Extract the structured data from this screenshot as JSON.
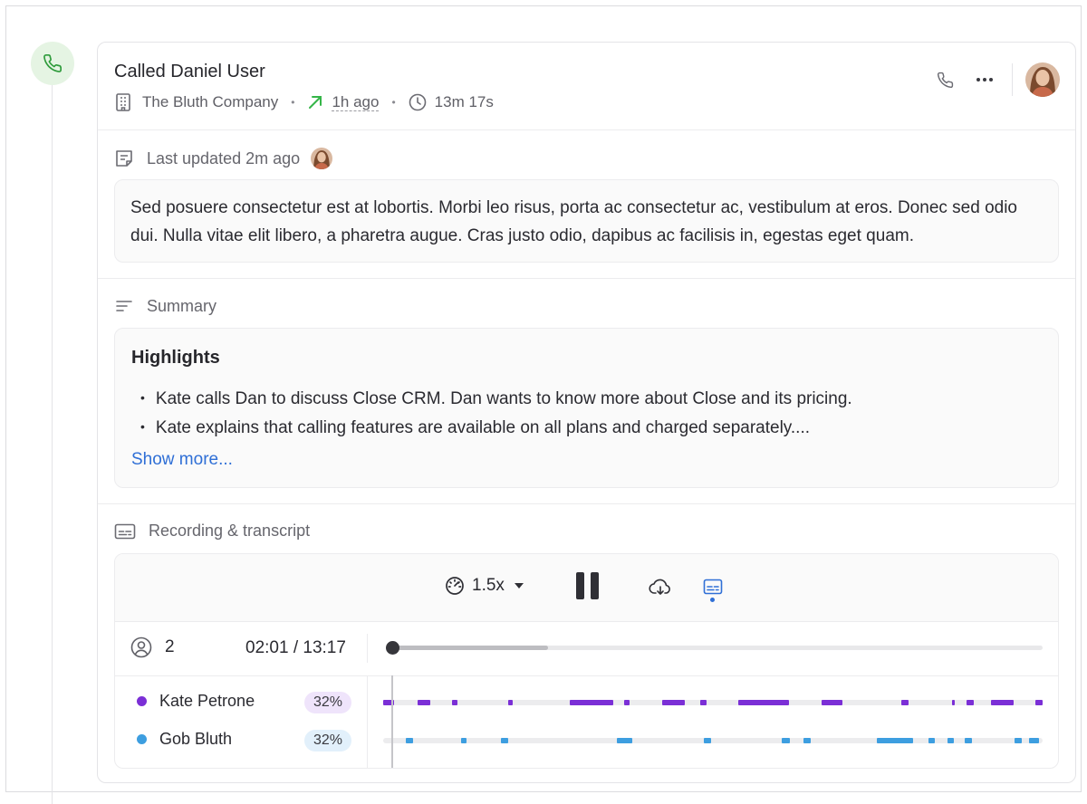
{
  "activity": {
    "title": "Called Daniel User",
    "company": "The Bluth Company",
    "time_ago": "1h ago",
    "duration": "13m 17s"
  },
  "note": {
    "updated_label": "Last updated 2m ago",
    "text": "Sed posuere consectetur est at lobortis. Morbi leo risus, porta ac consectetur ac, vestibulum at eros. Donec sed odio dui. Nulla vitae elit libero, a pharetra augue. Cras justo odio, dapibus ac facilisis in, egestas eget quam."
  },
  "summary": {
    "label": "Summary",
    "highlights_title": "Highlights",
    "bullets": [
      "Kate calls Dan to discuss Close CRM. Dan wants to know more about Close and its pricing.",
      "Kate explains that calling features are available on all plans and charged separately...."
    ],
    "show_more": "Show more..."
  },
  "recording": {
    "label": "Recording & transcript",
    "speed": "1.5x",
    "participants_count": "2",
    "time": "02:01 / 13:17",
    "progress_fraction": 0.24,
    "playhead_fraction": 0.0,
    "speakers": [
      {
        "name": "Kate Petrone",
        "percent": "32%",
        "color": "#7b2fd6",
        "badge_bg": "#efe4fb",
        "segments": [
          [
            0.0,
            0.017
          ],
          [
            0.052,
            0.072
          ],
          [
            0.104,
            0.112
          ],
          [
            0.189,
            0.197
          ],
          [
            0.283,
            0.349
          ],
          [
            0.366,
            0.374
          ],
          [
            0.423,
            0.457
          ],
          [
            0.481,
            0.491
          ],
          [
            0.538,
            0.615
          ],
          [
            0.665,
            0.696
          ],
          [
            0.786,
            0.797
          ],
          [
            0.862,
            0.867
          ],
          [
            0.885,
            0.895
          ],
          [
            0.922,
            0.956
          ],
          [
            0.989,
            1.0
          ]
        ]
      },
      {
        "name": "Gob Bluth",
        "percent": "32%",
        "color": "#3d9ee0",
        "badge_bg": "#e2f0fb",
        "segments": [
          [
            0.034,
            0.045
          ],
          [
            0.118,
            0.127
          ],
          [
            0.179,
            0.19
          ],
          [
            0.354,
            0.378
          ],
          [
            0.486,
            0.497
          ],
          [
            0.605,
            0.617
          ],
          [
            0.638,
            0.649
          ],
          [
            0.749,
            0.804
          ],
          [
            0.827,
            0.837
          ],
          [
            0.856,
            0.866
          ],
          [
            0.882,
            0.893
          ],
          [
            0.958,
            0.969
          ],
          [
            0.98,
            0.995
          ]
        ]
      }
    ]
  },
  "colors": {
    "accent": "#2f6fd6",
    "call_green": "#2e9b3b",
    "call_bg": "#e5f4e3",
    "arrow_green": "#35b548"
  },
  "icons": {
    "call": "phone-icon",
    "company": "building-icon",
    "outgoing": "arrow-up-right-icon",
    "duration": "clock-icon",
    "note": "note-icon",
    "summary": "lines-icon",
    "recording": "subtitles-icon"
  }
}
